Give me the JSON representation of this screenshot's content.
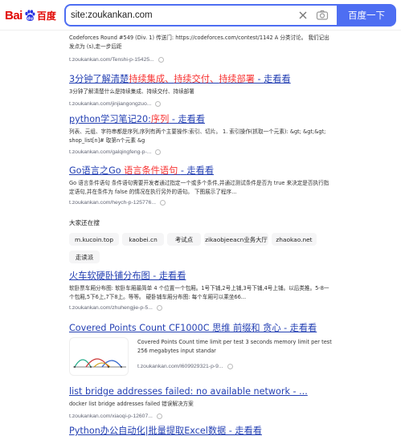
{
  "header": {
    "logo_text_bai": "Bai",
    "logo_text_du": "百度",
    "search_value": "site:zoukankan.com",
    "search_button": "百度一下"
  },
  "top_result": {
    "abstract": "Codeforces Round #549 (Div. 1) 传送门: https://codeforces.com/contest/1142 A 分类讨论。 我们记出发点为 (s),走一步后距",
    "url": "t.zoukankan.com/Tenshi-p-15425..."
  },
  "results": [
    {
      "title_hl_parts": [
        "3分钟了解清楚",
        "持续集成",
        "、",
        "持续交付",
        "、",
        "持续部署",
        " - ",
        "走看看"
      ],
      "abstract": "3分钟了解清楚什么是持续集成、持续交付、持续部署",
      "url": "t.zoukankan.com/jinjiangongzuo..."
    },
    {
      "title_hl_parts": [
        "python学习笔记20:",
        "序列",
        " - ",
        "走看看"
      ],
      "abstract": "列表、元组、字符串都是序列,序列有两个主要操作:索引、切片。 1. 索引操作(抓取一个元素): &gt; &gt;&gt; shop_list[n]# 取第n个元素 &g",
      "url": "t.zoukankan.com/galqingfeng-p-..."
    },
    {
      "title_hl_parts": [
        "Go语言之Go",
        " 语言条件语句 ",
        "- ",
        "走看看"
      ],
      "abstract": "Go 语言条件语句 条件语句需要开发者通过指定一个或多个条件,并通过测试条件是否为 true 来决定是否执行指定语句,并在条件为 false 的情况在执行另外的语句。 下图展示了程序...",
      "url": "t.zoukankan.com/heych-p-125776..."
    }
  ],
  "related": {
    "title": "大家还在搜",
    "chips": [
      "m.kucoin.top",
      "kaobei.cn",
      "考试点",
      "zikaobjeeacn业务大厅",
      "zhaokao.net",
      "走读派"
    ]
  },
  "results2": [
    {
      "title": "火车软硬卧铺分布图 - 走看看",
      "abstract": "软卧票车厢分布图: 软卧车厢最简单 4 个位置一个包厢。1号下铺,2号上铺,3号下铺,4号上铺。以后类推。5-8一个包厢,5下6上,7下8上。等等。 硬卧铺车厢分布图: 每个车厢可以乘坐66...",
      "url": "t.zoukankan.com/zhuhengjie-p-5..."
    },
    {
      "title": "Covered Points Count CF1000C 思维 前缀和 贪心 - 走看看",
      "abstract": "Covered Points Count time limit per test 3 seconds memory limit per test 256 megabytes input standar",
      "url": "t.zoukankan.com/l609929321-p-9..."
    },
    {
      "title": "list bridge addresses failed: no available network - ...",
      "abstract": "docker list bridge addresses failed 错误解决方案",
      "url": "t.zoukankan.com/xiaoqi-p-12607..."
    },
    {
      "title": "Python办公自动化|批量提取Excel数据 - 走看看",
      "abstract": "",
      "url": ""
    }
  ],
  "colors": {
    "accent": "#4e6ef2",
    "link": "#2440b3",
    "logo_red": "#e10602"
  }
}
